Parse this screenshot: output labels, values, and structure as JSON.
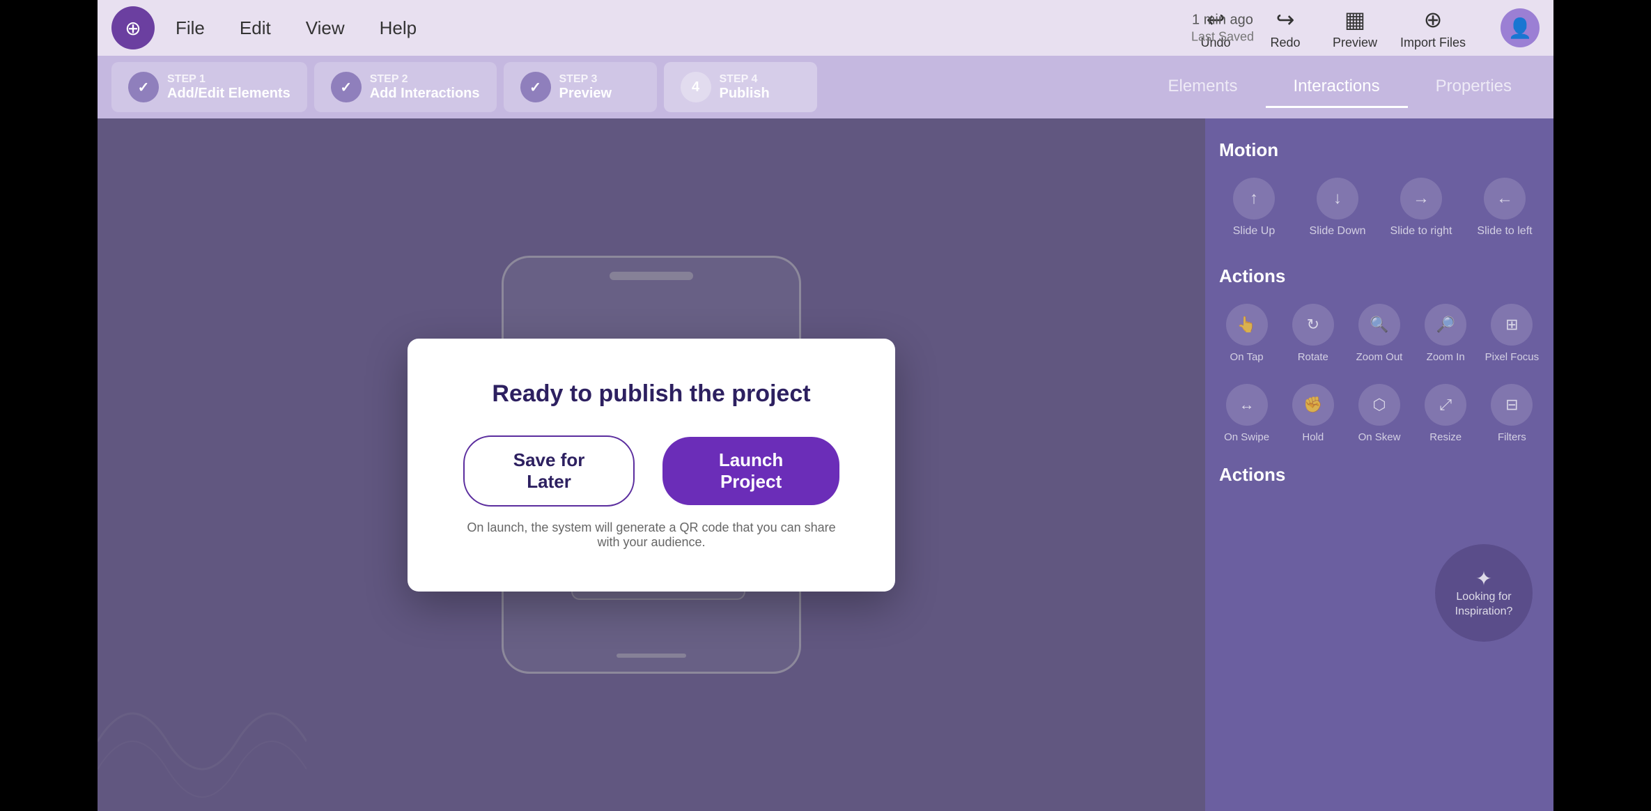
{
  "header": {
    "logo_icon": "⊕",
    "nav_items": [
      "File",
      "Edit",
      "View",
      "Help"
    ],
    "saved_time": "1 min ago",
    "saved_label": "Last Saved",
    "actions": [
      {
        "label": "Undo",
        "icon": "↩"
      },
      {
        "label": "Redo",
        "icon": "↪"
      },
      {
        "label": "Preview",
        "icon": "▦"
      },
      {
        "label": "Import Files",
        "icon": "⊕"
      }
    ]
  },
  "steps": [
    {
      "num": "STEP 1",
      "name": "Add/Edit Elements",
      "completed": true
    },
    {
      "num": "STEP 2",
      "name": "Add Interactions",
      "completed": true
    },
    {
      "num": "STEP 3",
      "name": "Preview",
      "completed": true
    },
    {
      "num": "STEP 4",
      "name": "Publish",
      "completed": false
    }
  ],
  "panel_tabs": [
    "Elements",
    "Interactions",
    "Properties"
  ],
  "panel": {
    "motion_title": "Motion",
    "motion_items": [
      {
        "label": "Slide Up",
        "icon": "↑"
      },
      {
        "label": "Slide Down",
        "icon": "↓"
      },
      {
        "label": "Slide to right",
        "icon": "→"
      },
      {
        "label": "Slide to left",
        "icon": "←"
      }
    ],
    "actions_title": "Actions",
    "actions_items_row1": [
      {
        "label": "On Tap",
        "icon": "👆"
      },
      {
        "label": "Rotate",
        "icon": "↻"
      },
      {
        "label": "Zoom Out",
        "icon": "🔍"
      },
      {
        "label": "Zoom In",
        "icon": "🔎"
      },
      {
        "label": "Pixel Focus",
        "icon": "⊞"
      }
    ],
    "actions_items_row2": [
      {
        "label": "On Swipe",
        "icon": "↔"
      },
      {
        "label": "Hold",
        "icon": "✊"
      },
      {
        "label": "On Skew",
        "icon": "⬡"
      },
      {
        "label": "Resize",
        "icon": "⤢"
      },
      {
        "label": "Filters",
        "icon": "⊟"
      }
    ],
    "actions_title2": "Actions",
    "inspiration_label": "Looking for Inspiration?"
  },
  "modal": {
    "title": "Ready to publish the project",
    "save_later_label": "Save for Later",
    "launch_label": "Launch Project",
    "note": "On launch, the system will generate a QR code that you can share with your audience."
  }
}
